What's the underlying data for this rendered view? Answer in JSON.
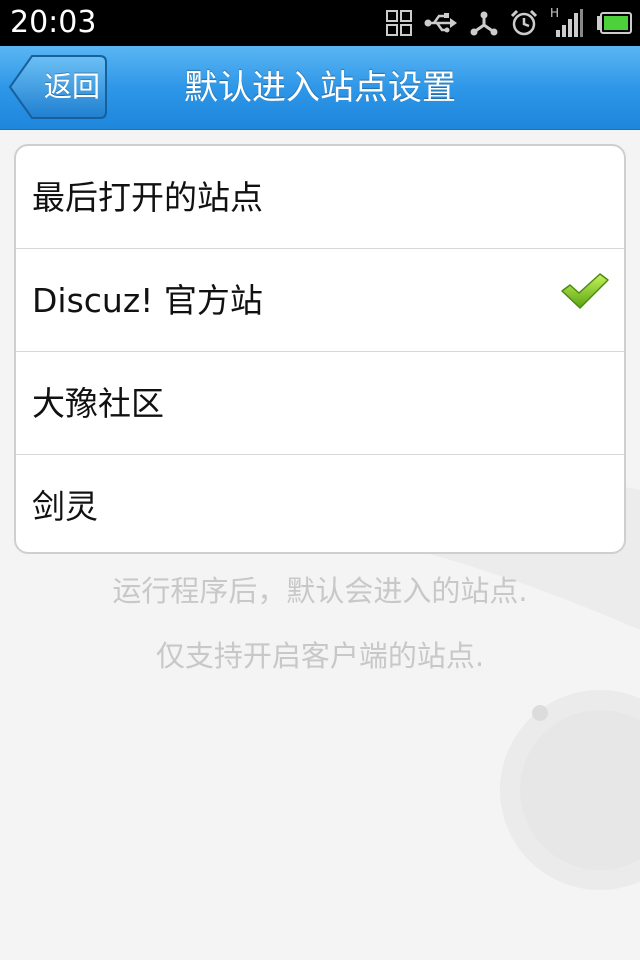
{
  "status_bar": {
    "time": "20:03",
    "icons": [
      "grid-icon",
      "usb-icon",
      "share-icon",
      "alarm-icon",
      "signal-icon",
      "battery-icon"
    ],
    "signal_label": "H"
  },
  "header": {
    "back_label": "返回",
    "title": "默认进入站点设置",
    "accent_color": "#2f97e8"
  },
  "options": [
    {
      "label": "最后打开的站点",
      "selected": false
    },
    {
      "label": "Discuz! 官方站",
      "selected": true
    },
    {
      "label": "大豫社区",
      "selected": false
    },
    {
      "label": "剑灵",
      "selected": false
    }
  ],
  "hints": [
    "运行程序后，默认会进入的站点.",
    "仅支持开启客户端的站点."
  ]
}
